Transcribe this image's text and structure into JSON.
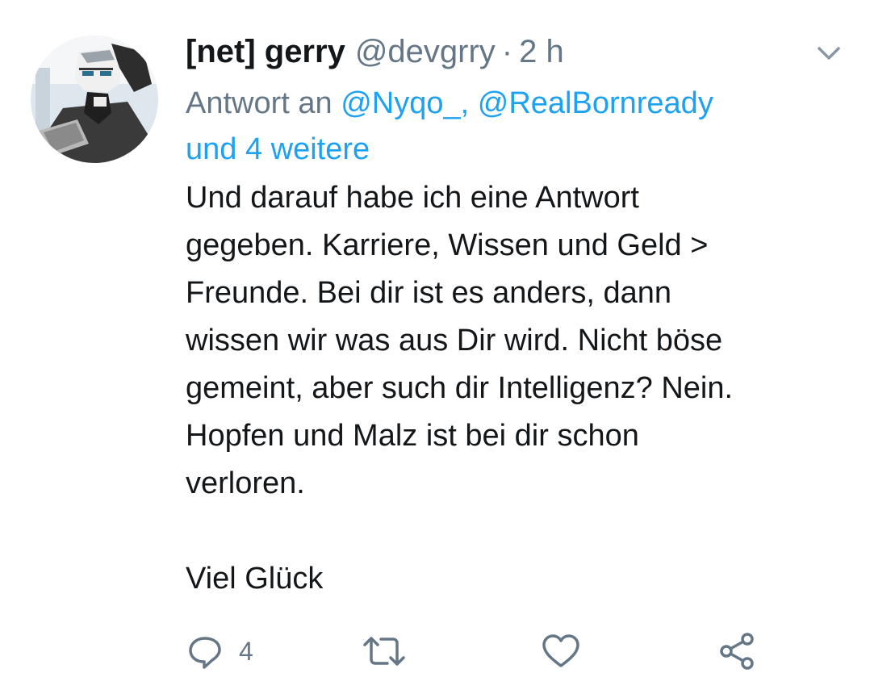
{
  "tweet": {
    "display_name": "[net] gerry",
    "handle": "@devgrry",
    "separator": "·",
    "time": "2 h",
    "reply": {
      "prefix": "Antwort an ",
      "mention_1": "@Nyqo_,",
      "mention_2": "@RealBornready",
      "more": "und 4 weitere"
    },
    "text": "Und darauf habe ich eine Antwort\ngegeben. Karriere, Wissen und Geld >\nFreunde. Bei dir ist es anders, dann\nwissen wir was aus Dir wird. Nicht böse\ngemeint, aber such dir Intelligenz? Nein.\nHopfen und Malz ist bei dir schon\nverloren.\n\nViel Glück",
    "actions": {
      "reply_count": "4",
      "icons": [
        "reply-icon",
        "retweet-icon",
        "like-icon",
        "share-icon"
      ]
    }
  },
  "colors": {
    "link": "#1da1f2",
    "secondary": "#657786",
    "text": "#14171a"
  }
}
